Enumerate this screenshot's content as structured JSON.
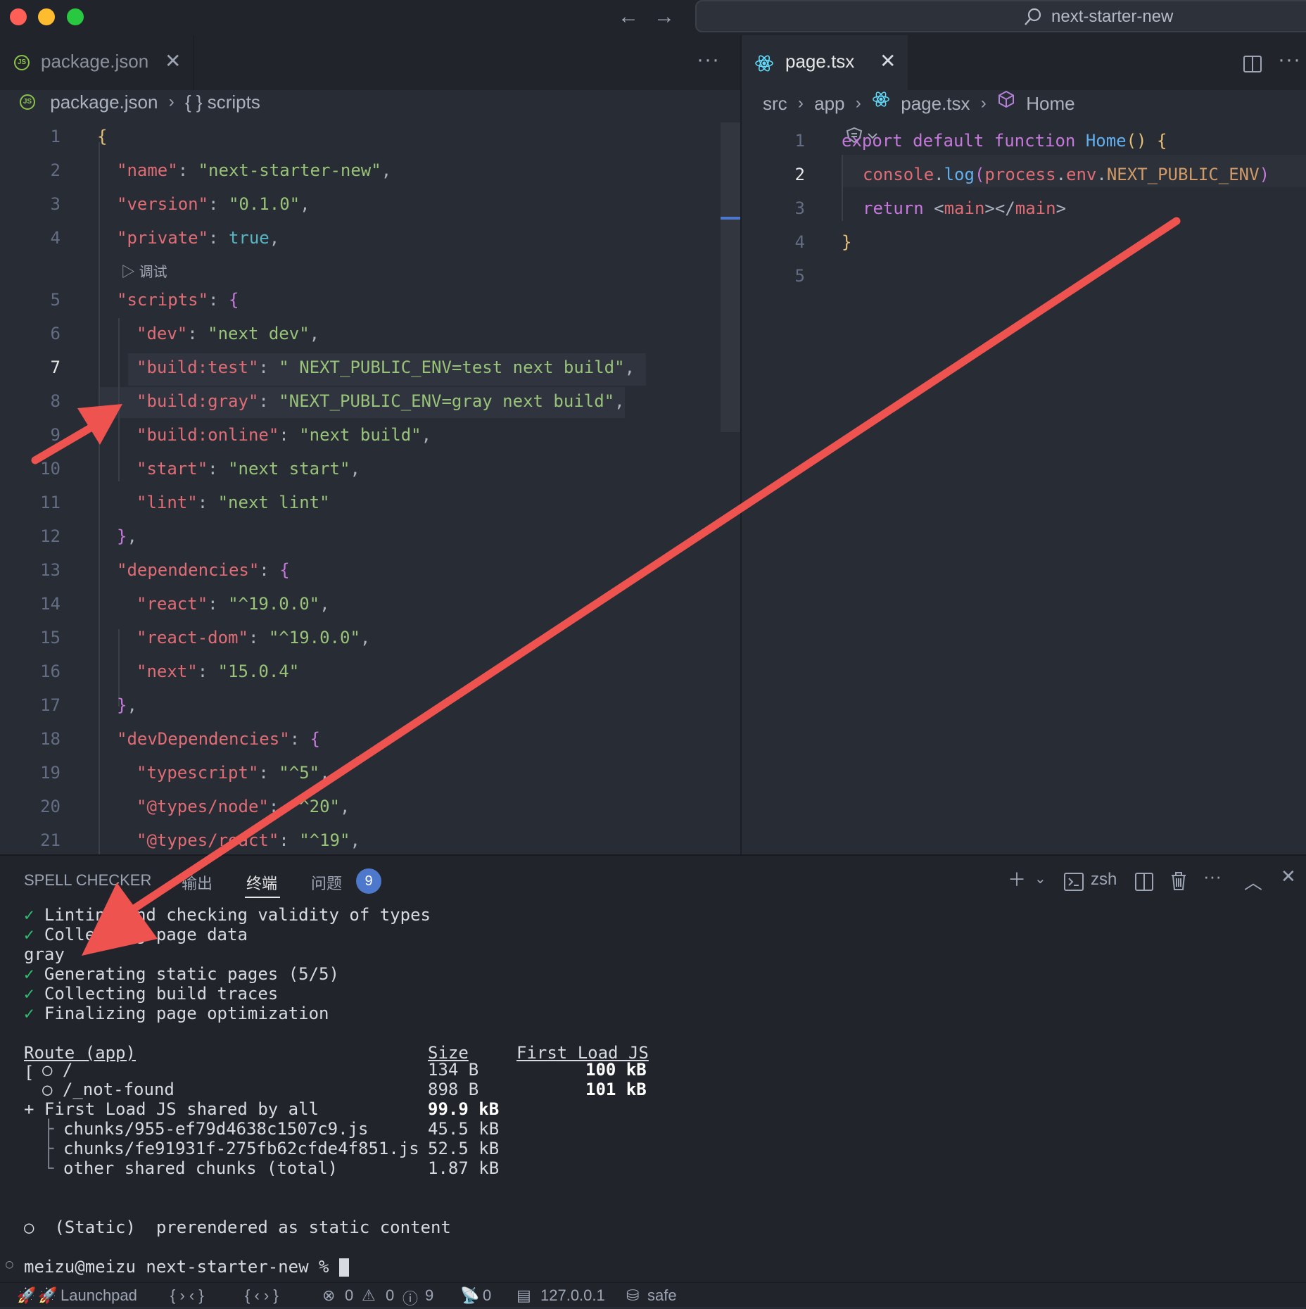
{
  "window": {
    "search_text": "next-starter-new"
  },
  "left_editor": {
    "tab_label": "package.json",
    "breadcrumb": [
      "package.json",
      "{ } scripts"
    ],
    "codelens": "调试",
    "lines": [
      {
        "n": "1",
        "text": "{"
      },
      {
        "n": "2",
        "text": "\"name\": \"next-starter-new\","
      },
      {
        "n": "3",
        "text": "\"version\": \"0.1.0\","
      },
      {
        "n": "4",
        "text": "\"private\": true,"
      },
      {
        "n": "5",
        "text": "\"scripts\": {"
      },
      {
        "n": "6",
        "text": "\"dev\": \"next dev\","
      },
      {
        "n": "7",
        "text": "\"build:test\": \" NEXT_PUBLIC_ENV=test next build\","
      },
      {
        "n": "8",
        "text": "\"build:gray\": \"NEXT_PUBLIC_ENV=gray next build\","
      },
      {
        "n": "9",
        "text": "\"build:online\": \"next build\","
      },
      {
        "n": "10",
        "text": "\"start\": \"next start\","
      },
      {
        "n": "11",
        "text": "\"lint\": \"next lint\""
      },
      {
        "n": "12",
        "text": "},"
      },
      {
        "n": "13",
        "text": "\"dependencies\": {"
      },
      {
        "n": "14",
        "text": "\"react\": \"^19.0.0\","
      },
      {
        "n": "15",
        "text": "\"react-dom\": \"^19.0.0\","
      },
      {
        "n": "16",
        "text": "\"next\": \"15.0.4\""
      },
      {
        "n": "17",
        "text": "},"
      },
      {
        "n": "18",
        "text": "\"devDependencies\": {"
      },
      {
        "n": "19",
        "text": "\"typescript\": \"^5\","
      },
      {
        "n": "20",
        "text": "\"@types/node\": \"^20\","
      },
      {
        "n": "21",
        "text": "\"@types/react\": \"^19\","
      }
    ]
  },
  "right_editor": {
    "tab_label": "page.tsx",
    "breadcrumb": [
      "src",
      "app",
      "page.tsx",
      "Home"
    ],
    "lines": [
      {
        "n": "1",
        "text": "export default function Home() {"
      },
      {
        "n": "2",
        "text": "console.log(process.env.NEXT_PUBLIC_ENV)"
      },
      {
        "n": "3",
        "text": "return <main></main>"
      },
      {
        "n": "4",
        "text": "}"
      },
      {
        "n": "5",
        "text": ""
      }
    ]
  },
  "panel": {
    "tabs": {
      "spell": "SPELL CHECKER",
      "output": "输出",
      "terminal": "终端",
      "problems": "问题"
    },
    "problems_count": "9",
    "shell": "zsh",
    "terminal": {
      "l1": "Linting and checking validity of types",
      "l2": "Collecting page data",
      "l3": "gray",
      "l4": "Generating static pages (5/5)",
      "l5": "Collecting build traces",
      "l6": "Finalizing page optimization",
      "h_route": "Route (app)",
      "h_size": "Size",
      "h_first": "First Load JS",
      "r1_route": "○ /",
      "r1_size": "134 B",
      "r1_first": "100 kB",
      "r2_route": "○ /_not-found",
      "r2_size": "898 B",
      "r2_first": "101 kB",
      "shared": "+ First Load JS shared by all",
      "shared_size": "99.9 kB",
      "c1": "chunks/955-ef79d4638c1507c9.js",
      "c1_size": "45.5 kB",
      "c2": "chunks/fe91931f-275fb62cfde4f851.js",
      "c2_size": "52.5 kB",
      "c3": "other shared chunks (total)",
      "c3_size": "1.87 kB",
      "legend": "○  (Static)  prerendered as static content",
      "prompt": "meizu@meizu next-starter-new % "
    }
  },
  "statusbar": {
    "launchpad": "Launchpad",
    "errors": "0",
    "warnings": "0",
    "infos": "9",
    "ports": "0",
    "host": "127.0.0.1",
    "safe": "safe"
  },
  "colors": {
    "accent": "#4d78cc",
    "arrow": "#ef5350"
  }
}
